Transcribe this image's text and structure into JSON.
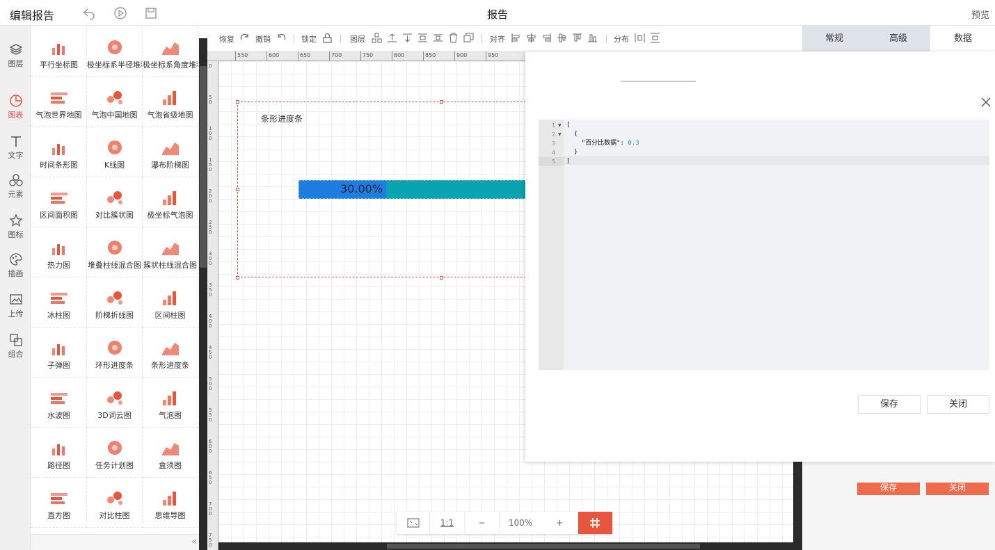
{
  "header": {
    "app_title": "编辑报告",
    "page_title": "报告",
    "preview_label": "预览",
    "icons": [
      "undo-icon",
      "play-icon",
      "save-icon"
    ]
  },
  "leftnav": {
    "items": [
      {
        "label": "图层",
        "icon": "layers-icon"
      },
      {
        "label": "图表",
        "icon": "chart-icon",
        "active": true
      },
      {
        "label": "文字",
        "icon": "text-icon"
      },
      {
        "label": "元素",
        "icon": "elements-icon"
      },
      {
        "label": "图标",
        "icon": "star-icon"
      },
      {
        "label": "插画",
        "icon": "palette-icon"
      },
      {
        "label": "上传",
        "icon": "upload-image-icon"
      },
      {
        "label": "组合",
        "icon": "group-icon"
      }
    ]
  },
  "chart_panel": {
    "items": [
      "平行坐标图",
      "极坐标系半径堆积",
      "极坐标系角度堆积",
      "气泡世界地图",
      "气泡中国地图",
      "气泡省级地图",
      "时间条形图",
      "K线图",
      "瀑布阶梯图",
      "区间面积图",
      "对比簇状图",
      "极坐标气泡图",
      "热力图",
      "堆叠柱线混合图",
      "簇状柱线混合图",
      "冰柱图",
      "阶梯折线图",
      "区间柱图",
      "子弹图",
      "环形进度条",
      "条形进度条",
      "水波图",
      "3D词云图",
      "气泡图",
      "路径图",
      "任务计划图",
      "盒须图",
      "直方图",
      "对比柱图",
      "思维导图"
    ]
  },
  "toolbar": {
    "restore": "恢复",
    "undo": "撤销",
    "lock": "锁定",
    "layer": "图层",
    "align": "对齐",
    "distribute": "分布"
  },
  "ruler": {
    "top_ticks": [
      "550",
      "600",
      "650",
      "700",
      "750",
      "800",
      "850",
      "900",
      "950"
    ],
    "left_ticks": [
      "0",
      "50",
      "100",
      "150",
      "200",
      "250",
      "300",
      "350",
      "400",
      "450",
      "500",
      "550",
      "600",
      "650",
      "700",
      "750"
    ]
  },
  "widget": {
    "title": "条形进度条",
    "percent_text": "30.00%",
    "value": 0.3,
    "fill_color": "#1f7de1",
    "track_color": "#0aa3b0"
  },
  "zoom": {
    "fit_label": "",
    "one_to_one": "1:1",
    "minus": "−",
    "level": "100%",
    "plus": "+"
  },
  "right_tabs": [
    "常规",
    "高级",
    "数据"
  ],
  "right_panel": {
    "save": "保存",
    "close": "关闭"
  },
  "dialog": {
    "code_lines": [
      "[",
      "  {",
      "    \"百分比数据\": 0.3",
      "  }",
      "]"
    ],
    "line_numbers": [
      "1",
      "2",
      "3",
      "4",
      "5"
    ],
    "save_button": "保存",
    "close_button": "关闭"
  },
  "colors": {
    "accent": "#e8553e",
    "chart_icon": "#e8553e"
  }
}
